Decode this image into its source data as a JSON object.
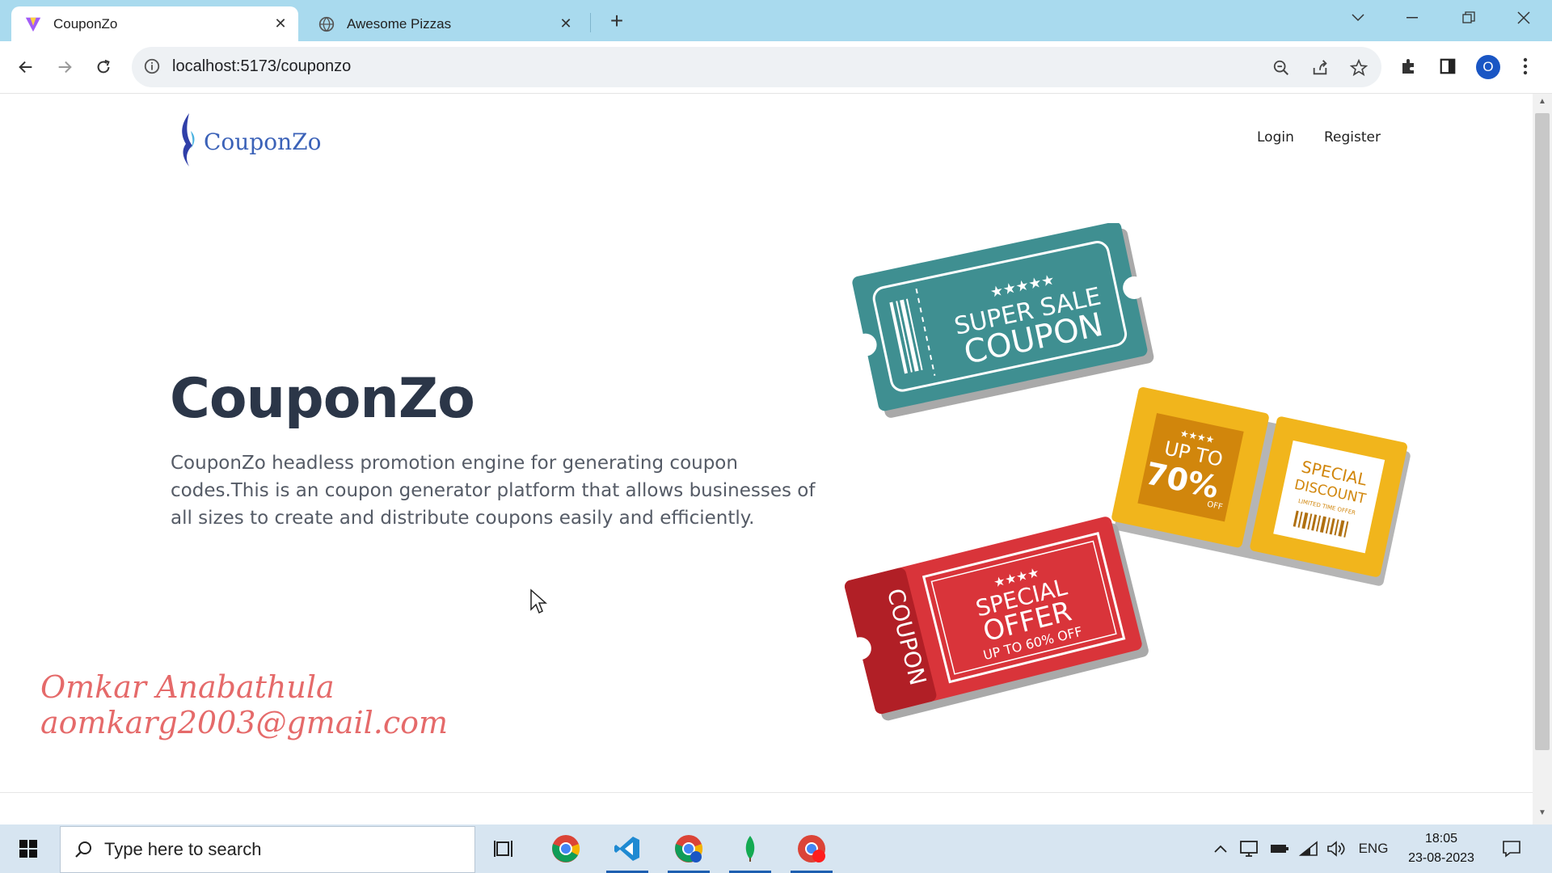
{
  "browser": {
    "tabs": [
      {
        "title": "CouponZo",
        "active": true,
        "favicon": "vite-icon"
      },
      {
        "title": "Awesome Pizzas",
        "active": false,
        "favicon": "globe-icon"
      }
    ],
    "url": "localhost:5173/couponzo"
  },
  "page": {
    "logo_text": "CouponZo",
    "nav": {
      "login": "Login",
      "register": "Register"
    },
    "hero": {
      "title": "CouponZo",
      "description": "CouponZo headless promotion engine for generating coupon codes.This is an coupon generator platform that allows businesses of all sizes to create and distribute coupons easily and efficiently."
    },
    "signature": {
      "name": "Omkar Anabathula",
      "email": "aomkarg2003@gmail.com"
    },
    "tickets": {
      "teal": {
        "line1": "SUPER SALE",
        "line2": "COUPON",
        "stars": "★★★★★",
        "color": "#3f8f91"
      },
      "yellow_left": {
        "line1": "UP TO",
        "line2": "70%",
        "line3": "OFF",
        "stars": "★★★★",
        "color": "#f1b51c"
      },
      "yellow_right": {
        "line1": "SPECIAL",
        "line2": "DISCOUNT",
        "line3": "LIMITED TIME OFFER",
        "color": "#f1b51c"
      },
      "red": {
        "side": "COUPON",
        "line1": "SPECIAL",
        "line2": "OFFER",
        "line3": "UP TO 60% OFF",
        "stars": "★★★★",
        "color": "#d9343a"
      }
    }
  },
  "taskbar": {
    "search_placeholder": "Type here to search",
    "language": "ENG",
    "time": "18:05",
    "date": "23-08-2023"
  },
  "colors": {
    "tabbar": "#a9daee",
    "title": "#2b3648",
    "logo": "#3b62b8",
    "signature": "#e56a6a"
  }
}
